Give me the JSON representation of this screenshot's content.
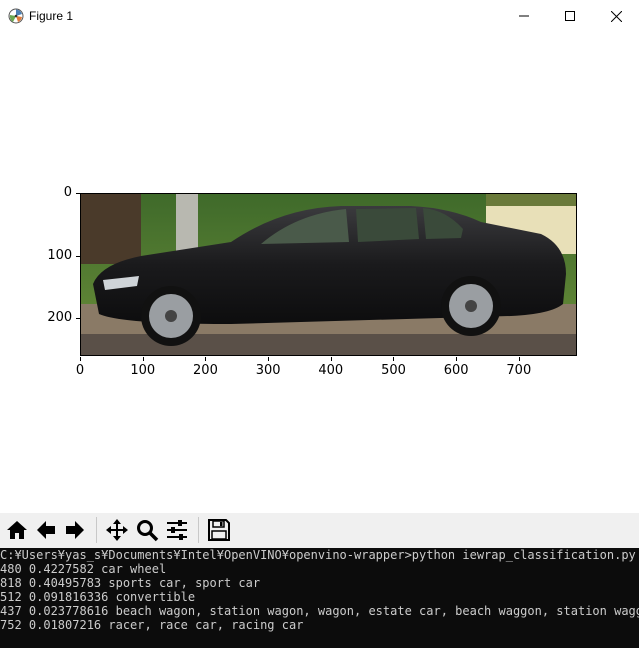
{
  "window": {
    "title": "Figure 1",
    "icons": {
      "app": "matplotlib-figure-icon",
      "minimize": "minimize-icon",
      "maximize": "maximize-icon",
      "close": "close-icon"
    }
  },
  "figure": {
    "image_description_icon": "car-photo",
    "x_ticks": [
      "0",
      "100",
      "200",
      "300",
      "400",
      "500",
      "600",
      "700"
    ],
    "y_ticks": [
      "0",
      "100",
      "200"
    ],
    "x_range": [
      0,
      793
    ],
    "y_range": [
      260,
      0
    ]
  },
  "toolbar": {
    "buttons": [
      "home-icon",
      "back-icon",
      "forward-icon",
      "pan-icon",
      "zoom-icon",
      "configure-subplots-icon",
      "save-icon"
    ]
  },
  "console": {
    "lines": [
      "C:¥Users¥yas_s¥Documents¥Intel¥OpenVINO¥openvino-wrapper>python iewrap_classification.py",
      "480 0.4227582 car wheel",
      "818 0.40495783 sports car, sport car",
      "512 0.091816336 convertible",
      "437 0.023778616 beach wagon, station wagon, wagon, estate car, beach waggon, station waggon",
      "752 0.01807216 racer, race car, racing car"
    ]
  }
}
